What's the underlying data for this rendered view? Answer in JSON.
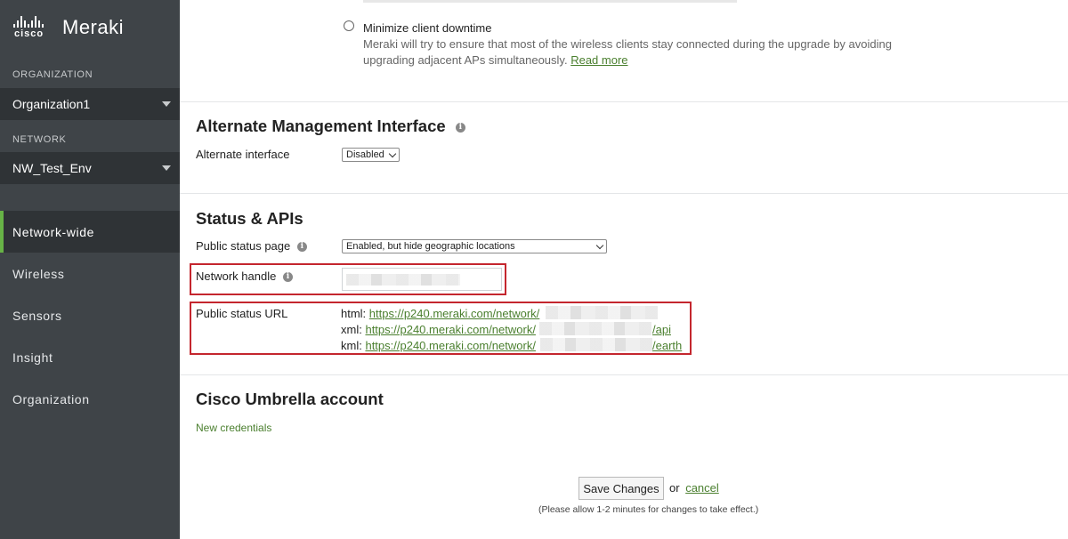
{
  "brand": {
    "company": "cisco",
    "product": "Meraki"
  },
  "sidebar": {
    "organization_label": "ORGANIZATION",
    "organization_value": "Organization1",
    "network_label": "NETWORK",
    "network_value": "NW_Test_Env",
    "nav": [
      {
        "label": "Network-wide",
        "active": true
      },
      {
        "label": "Wireless",
        "active": false
      },
      {
        "label": "Sensors",
        "active": false
      },
      {
        "label": "Insight",
        "active": false
      },
      {
        "label": "Organization",
        "active": false
      }
    ]
  },
  "upgrade": {
    "option_label": "Minimize client downtime",
    "description_line1": "Meraki will try to ensure that most of the wireless clients stay connected during the upgrade by avoiding",
    "description_line2": "upgrading adjacent APs simultaneously.",
    "read_more": "Read more"
  },
  "alt_mgmt": {
    "title": "Alternate Management Interface",
    "field_label": "Alternate interface",
    "field_value": "Disabled"
  },
  "status_apis": {
    "title": "Status & APIs",
    "public_status_label": "Public status page",
    "public_status_value": "Enabled, but hide geographic locations",
    "network_handle_label": "Network handle",
    "public_url_label": "Public status URL",
    "urls": {
      "html_prefix": "html:",
      "html_url": "https://p240.meraki.com/network/",
      "xml_prefix": "xml:",
      "xml_url": "https://p240.meraki.com/network/",
      "xml_suffix": "/api",
      "kml_prefix": "kml:",
      "kml_url": "https://p240.meraki.com/network/",
      "kml_suffix": "/earth"
    }
  },
  "umbrella": {
    "title": "Cisco Umbrella account",
    "new_credentials": "New credentials"
  },
  "footer": {
    "save_label": "Save Changes",
    "or_text": "or",
    "cancel_label": "cancel",
    "note": "(Please allow 1-2 minutes for changes to take effect.)"
  },
  "colors": {
    "sidebar_bg": "#3f4448",
    "accent_green": "#67b346",
    "link_green": "#4a7f2e",
    "highlight_red": "#c4262e"
  },
  "icons": [
    "cisco-logo-icon",
    "chevron-down-icon",
    "info-icon",
    "radio-icon"
  ]
}
